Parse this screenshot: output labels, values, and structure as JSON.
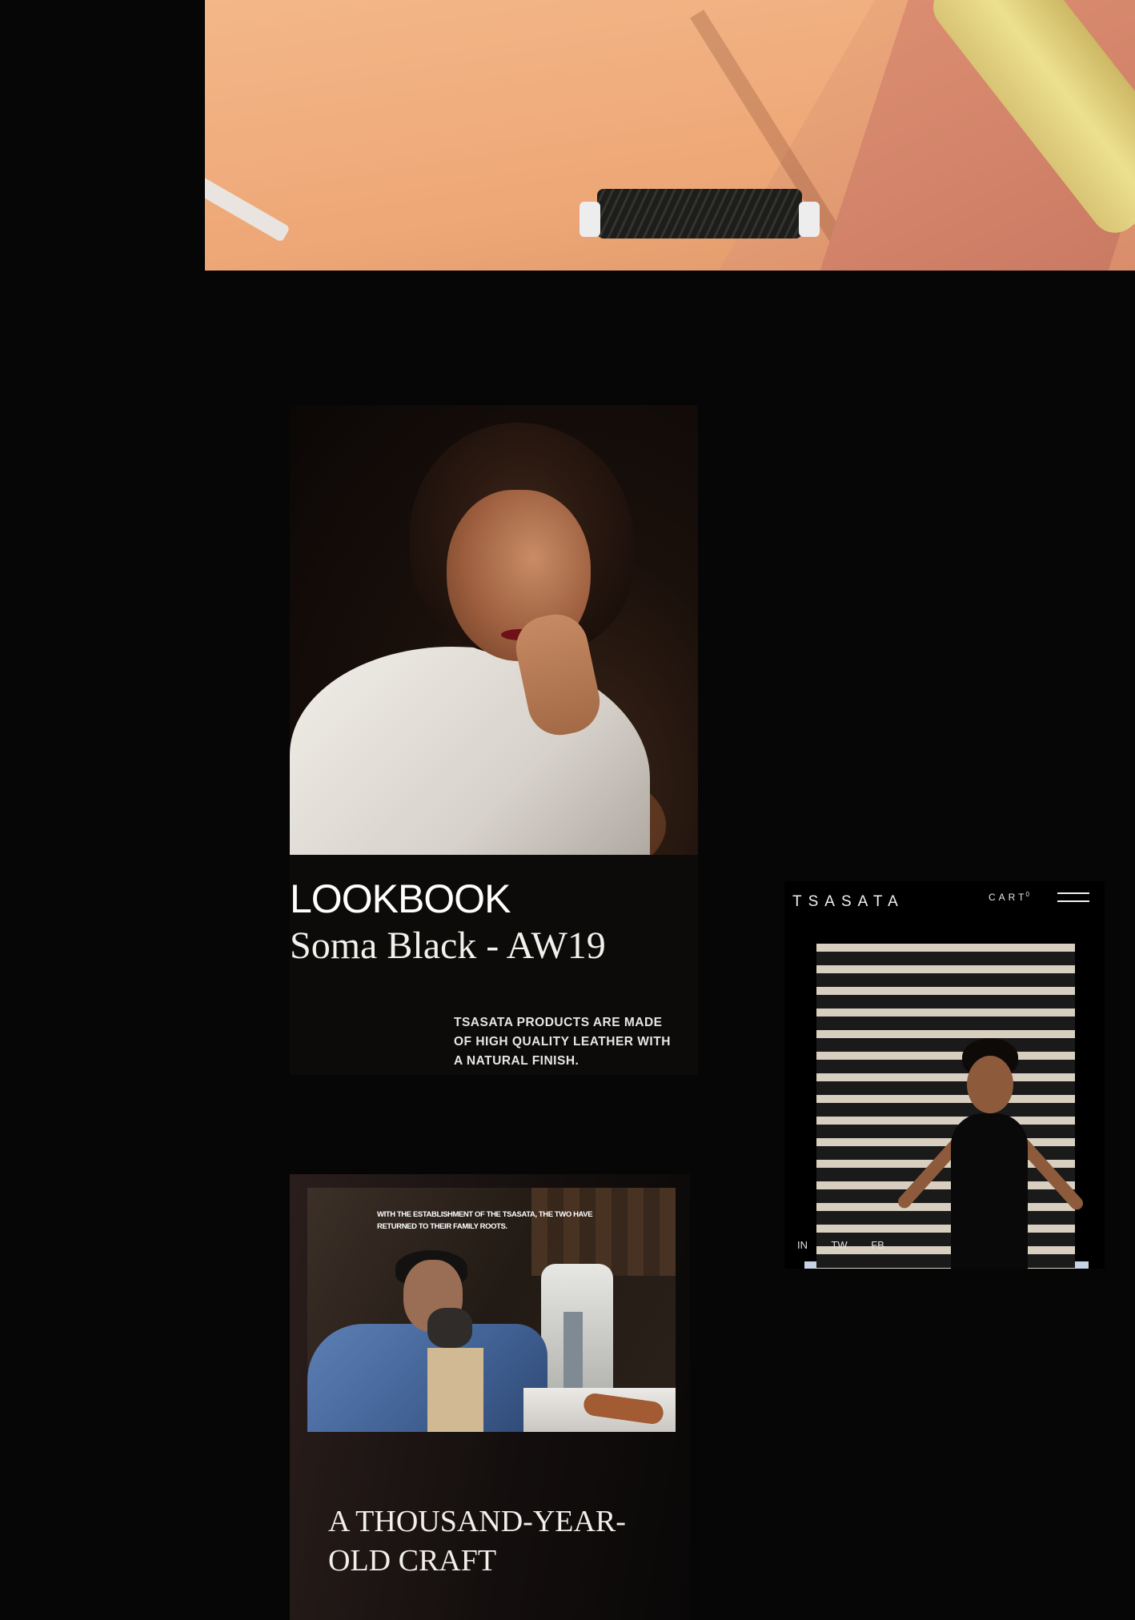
{
  "hero": {},
  "lookbook": {
    "heading": "LOOKBOOK",
    "subheading": "Soma Black - AW19",
    "blurb": "TSASATA PRODUCTS ARE MADE OF HIGH QUALITY LEATHER WITH A NATURAL FINISH."
  },
  "phone": {
    "brand": "TSASATA",
    "cart_label": "CART",
    "cart_count": "0",
    "menu_icon": "hamburger-menu-icon",
    "social": [
      "IN",
      "TW",
      "FB"
    ]
  },
  "craft": {
    "caption": "WITH THE ESTABLISHMENT OF THE TSASATA, THE TWO HAVE RETURNED TO THEIR FAMILY ROOTS.",
    "title": "A THOUSAND-YEAR-OLD CRAFT"
  },
  "colors": {
    "background": "#060606",
    "card": "#0c0b0a",
    "text": "#f2f2f2"
  }
}
